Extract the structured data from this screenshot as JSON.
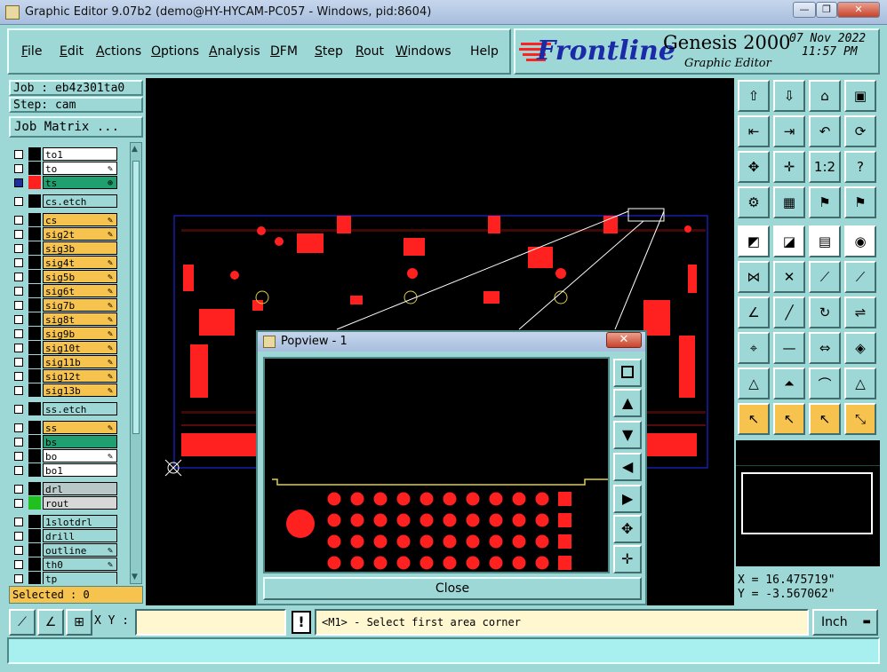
{
  "window": {
    "title": "Graphic Editor 9.07b2 (demo@HY-HYCAM-PC057 - Windows, pid:8604)",
    "minimize": "—",
    "restore": "❐",
    "close": "✕"
  },
  "menu": {
    "items": [
      "File",
      "Edit",
      "Actions",
      "Options",
      "Analysis",
      "DFM",
      "Step",
      "Rout",
      "Windows",
      "Help"
    ]
  },
  "brand": {
    "logo": "Frontline",
    "product": "Genesis 2000",
    "subtitle": "Graphic Editor",
    "date": "07 Nov 2022",
    "time": "11:57 PM"
  },
  "job": {
    "job_label": "Job : eb4z301ta0",
    "step_label": "Step: cam",
    "matrix_button": "Job Matrix ..."
  },
  "layers": [
    {
      "name": "to1",
      "color": "#ffffff",
      "swatch": "#000000",
      "flag": ""
    },
    {
      "name": "to",
      "color": "#ffffff",
      "swatch": "#000000",
      "flag": "✎"
    },
    {
      "name": "ts",
      "color": "#20a070",
      "swatch": "#ff2020",
      "flag": "⊕",
      "checked": true
    },
    {
      "name": "cs.etch",
      "color": "#9ed8d6",
      "swatch": "#000000",
      "flag": ""
    },
    {
      "name": "cs",
      "color": "#f7c34f",
      "swatch": "#000000",
      "flag": "✎"
    },
    {
      "name": "sig2t",
      "color": "#f7c34f",
      "swatch": "#000000",
      "flag": "✎"
    },
    {
      "name": "sig3b",
      "color": "#f7c34f",
      "swatch": "#000000",
      "flag": ""
    },
    {
      "name": "sig4t",
      "color": "#f7c34f",
      "swatch": "#000000",
      "flag": "✎"
    },
    {
      "name": "sig5b",
      "color": "#f7c34f",
      "swatch": "#000000",
      "flag": "✎"
    },
    {
      "name": "sig6t",
      "color": "#f7c34f",
      "swatch": "#000000",
      "flag": "✎"
    },
    {
      "name": "sig7b",
      "color": "#f7c34f",
      "swatch": "#000000",
      "flag": "✎"
    },
    {
      "name": "sig8t",
      "color": "#f7c34f",
      "swatch": "#000000",
      "flag": "✎"
    },
    {
      "name": "sig9b",
      "color": "#f7c34f",
      "swatch": "#000000",
      "flag": "✎"
    },
    {
      "name": "sig10t",
      "color": "#f7c34f",
      "swatch": "#000000",
      "flag": "✎"
    },
    {
      "name": "sig11b",
      "color": "#f7c34f",
      "swatch": "#000000",
      "flag": "✎"
    },
    {
      "name": "sig12t",
      "color": "#f7c34f",
      "swatch": "#000000",
      "flag": "✎"
    },
    {
      "name": "sig13b",
      "color": "#f7c34f",
      "swatch": "#000000",
      "flag": "✎"
    },
    {
      "name": "ss.etch",
      "color": "#9ed8d6",
      "swatch": "#000000",
      "flag": ""
    },
    {
      "name": "ss",
      "color": "#f7c34f",
      "swatch": "#000000",
      "flag": "✎"
    },
    {
      "name": "bs",
      "color": "#20a070",
      "swatch": "#000000",
      "flag": ""
    },
    {
      "name": "bo",
      "color": "#ffffff",
      "swatch": "#000000",
      "flag": "✎"
    },
    {
      "name": "bo1",
      "color": "#ffffff",
      "swatch": "#000000",
      "flag": ""
    },
    {
      "name": "drl",
      "color": "#b8c8c8",
      "swatch": "#000000",
      "flag": ""
    },
    {
      "name": "rout",
      "color": "#d8d8d8",
      "swatch": "#20c020",
      "flag": ""
    },
    {
      "name": "1slotdrl",
      "color": "#9ed8d6",
      "swatch": "#000000",
      "flag": ""
    },
    {
      "name": "drill",
      "color": "#9ed8d6",
      "swatch": "#000000",
      "flag": ""
    },
    {
      "name": "outline",
      "color": "#9ed8d6",
      "swatch": "#000000",
      "flag": "✎"
    },
    {
      "name": "th0",
      "color": "#9ed8d6",
      "swatch": "#000000",
      "flag": "✎"
    },
    {
      "name": "tp",
      "color": "#9ed8d6",
      "swatch": "#000000",
      "flag": ""
    }
  ],
  "selected": "Selected : 0",
  "popview": {
    "title": "Popview - 1",
    "close_x": "✕",
    "close_button": "Close"
  },
  "coords": {
    "x": "X = 16.475719\"",
    "y": "Y = -3.567062\""
  },
  "bottom": {
    "xy_label": "X Y :",
    "xy_value": "",
    "alert": "!",
    "prompt": "<M1> - Select first area corner",
    "units": "Inch"
  },
  "status": "",
  "icons": {
    "toolbox": [
      "layer-up-icon",
      "layer-down-icon",
      "home-icon",
      "window-icon",
      "pan-left-icon",
      "pan-right-icon",
      "undo-icon",
      "redraw-icon",
      "fit-icon",
      "center-icon",
      "zoom-ratio-icon",
      "help-icon",
      "snap-icon",
      "grid-icon",
      "traffic-light-icon",
      "traffic-light-alt-icon",
      "select-icon",
      "measure-icon",
      "ruler-icon",
      "circle-icon",
      "net-icon",
      "cross-icon",
      "point-icon",
      "pin-icon",
      "line-icon",
      "slash-icon",
      "rotate-icon",
      "flip-icon",
      "node-icon",
      "minus-icon",
      "resize-icon",
      "shapes-icon",
      "triangle-icon",
      "arrow-triangle-icon",
      "arc-icon",
      "edit-triangle-icon",
      "pointer-icon",
      "pointer-box-icon",
      "pointer-alt-icon",
      "route-icon"
    ]
  },
  "colors": {
    "panel": "#9ed8d6",
    "copper": "#ff2020",
    "highlight": "#f7c34f",
    "board_outline": "#2030ff"
  }
}
